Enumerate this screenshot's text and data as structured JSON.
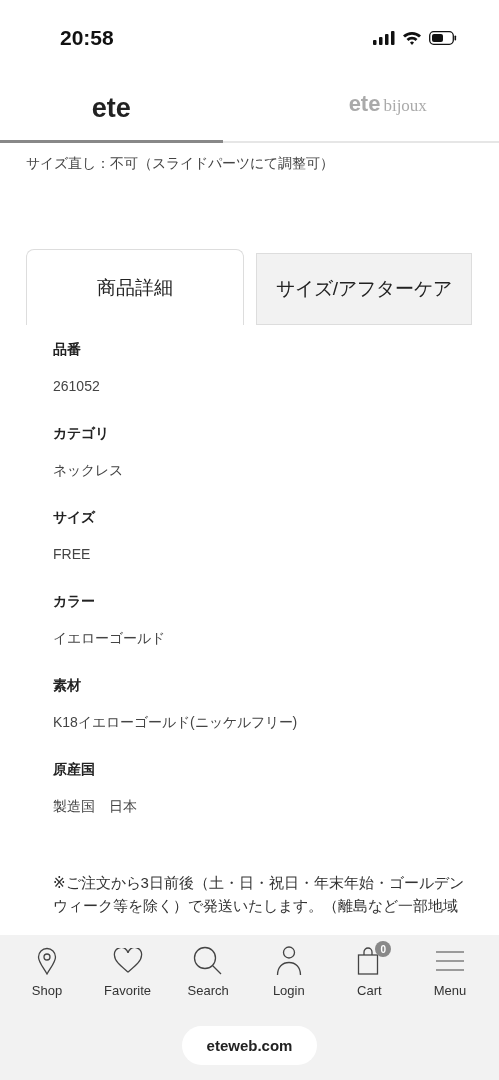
{
  "status_bar": {
    "time": "20:58"
  },
  "brand_tabs": [
    {
      "label": "ete",
      "selected": true
    },
    {
      "label": "ete",
      "sub": "bijoux",
      "selected": false
    }
  ],
  "size_note": "サイズ直し：不可（スライドパーツにて調整可）",
  "detail_tabs": [
    {
      "label": "商品詳細",
      "selected": true
    },
    {
      "label": "サイズ/アフターケア",
      "selected": false
    }
  ],
  "details": [
    {
      "label": "品番",
      "value": "261052"
    },
    {
      "label": "カテゴリ",
      "value": "ネックレス"
    },
    {
      "label": "サイズ",
      "value": "FREE"
    },
    {
      "label": "カラー",
      "value": "イエローゴールド"
    },
    {
      "label": "素材",
      "value": "K18イエローゴールド(ニッケルフリー)"
    },
    {
      "label": "原産国",
      "value": "製造国　日本"
    }
  ],
  "notice_lines": [
    "※ご注文から3日前後（土・日・祝日・年末年始・ゴールデン",
    "ウィーク等を除く）で発送いたします。（離島など一部地域"
  ],
  "bottom_nav": [
    {
      "kind": "pin",
      "label": "Shop"
    },
    {
      "kind": "heart",
      "label": "Favorite"
    },
    {
      "kind": "search",
      "label": "Search"
    },
    {
      "kind": "person",
      "label": "Login"
    },
    {
      "kind": "cart",
      "label": "Cart",
      "badge": "0"
    },
    {
      "kind": "menu",
      "label": "Menu"
    }
  ],
  "url": "eteweb.com"
}
